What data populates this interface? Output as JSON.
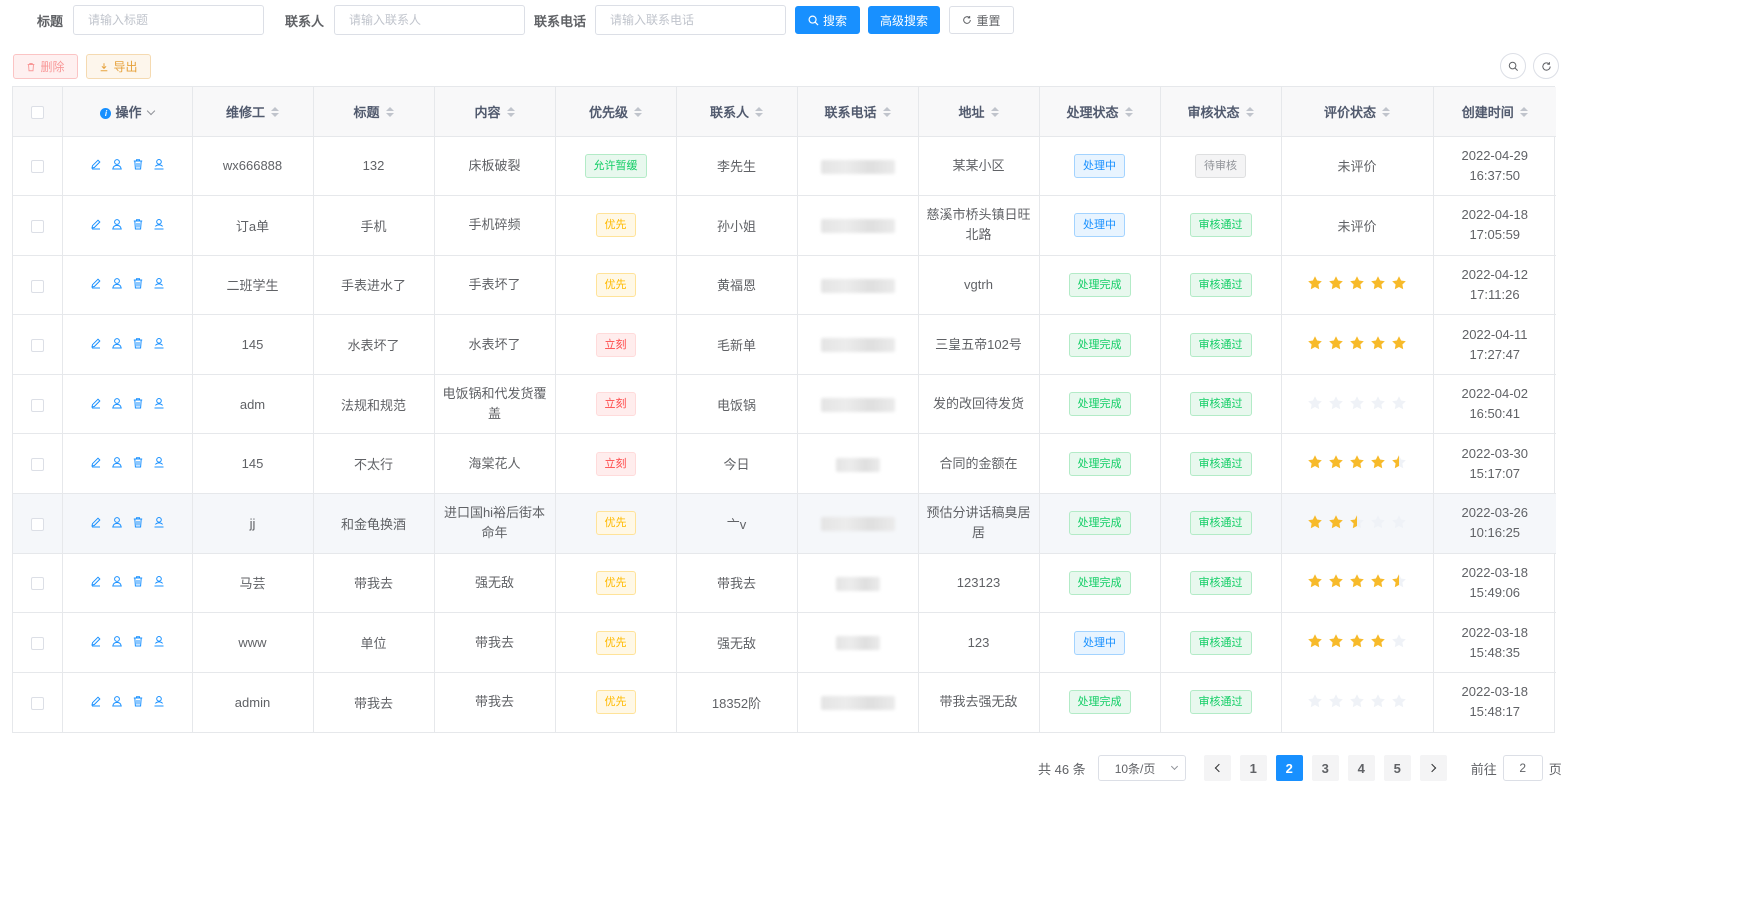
{
  "search": {
    "title_label": "标题",
    "title_placeholder": "请输入标题",
    "contact_label": "联系人",
    "contact_placeholder": "请输入联系人",
    "phone_label": "联系电话",
    "phone_placeholder": "请输入联系电话",
    "search_btn": "搜索",
    "advanced_btn": "高级搜索",
    "reset_btn": "重置"
  },
  "toolbar": {
    "delete_btn": "删除",
    "export_btn": "导出"
  },
  "table": {
    "headers": [
      "操作",
      "维修工",
      "标题",
      "内容",
      "优先级",
      "联系人",
      "联系电话",
      "地址",
      "处理状态",
      "审核状态",
      "评价状态",
      "创建时间"
    ],
    "rows": [
      {
        "worker": "wx666888",
        "title": "132",
        "content": "床板破裂",
        "priority": "允许暂缓",
        "priority_type": "success",
        "contact": "李先生",
        "address": "某某小区",
        "status": "处理中",
        "status_type": "primary",
        "audit": "待审核",
        "audit_type": "info",
        "eval_text": "未评价",
        "rating": null,
        "time": "2022-04-29 16:37:50"
      },
      {
        "worker": "订a单",
        "title": "手机",
        "content": "手机碎频",
        "priority": "优先",
        "priority_type": "warning",
        "contact": "孙小姐",
        "address": "慈溪市桥头镇日旺北路",
        "status": "处理中",
        "status_type": "primary",
        "audit": "审核通过",
        "audit_type": "success",
        "eval_text": "未评价",
        "rating": null,
        "time": "2022-04-18 17:05:59"
      },
      {
        "worker": "二班学生",
        "title": "手表进水了",
        "content": "手表坏了",
        "priority": "优先",
        "priority_type": "warning",
        "contact": "黄福恩",
        "address": "vgtrh",
        "status": "处理完成",
        "status_type": "success",
        "audit": "审核通过",
        "audit_type": "success",
        "eval_text": "",
        "rating": 5,
        "time": "2022-04-12 17:11:26"
      },
      {
        "worker": "145",
        "title": "水表坏了",
        "content": "水表坏了",
        "priority": "立刻",
        "priority_type": "danger",
        "contact": "毛新单",
        "address": "三皇五帝102号",
        "status": "处理完成",
        "status_type": "success",
        "audit": "审核通过",
        "audit_type": "success",
        "eval_text": "",
        "rating": 5,
        "time": "2022-04-11 17:27:47"
      },
      {
        "worker": "adm",
        "title": "法规和规范",
        "content": "电饭锅和代发货覆盖",
        "priority": "立刻",
        "priority_type": "danger",
        "contact": "电饭锅",
        "address": "发的改回待发货",
        "status": "处理完成",
        "status_type": "success",
        "audit": "审核通过",
        "audit_type": "success",
        "eval_text": "",
        "rating": 0,
        "time": "2022-04-02 16:50:41"
      },
      {
        "worker": "145",
        "title": "不太行",
        "content": "海棠花人",
        "priority": "立刻",
        "priority_type": "danger",
        "contact": "今日",
        "address": "合同的金额在",
        "status": "处理完成",
        "status_type": "success",
        "audit": "审核通过",
        "audit_type": "success",
        "eval_text": "",
        "rating": 4.5,
        "time": "2022-03-30 15:17:07"
      },
      {
        "worker": "jj",
        "title": "和金龟换酒",
        "content": "进口国hi裕后街本命年",
        "priority": "优先",
        "priority_type": "warning",
        "contact": "亠v",
        "address": "预估分讲话稿臭居居",
        "status": "处理完成",
        "status_type": "success",
        "audit": "审核通过",
        "audit_type": "success",
        "eval_text": "",
        "rating": 2.5,
        "time": "2022-03-26 10:16:25"
      },
      {
        "worker": "马芸",
        "title": "带我去",
        "content": "强无敌",
        "priority": "优先",
        "priority_type": "warning",
        "contact": "带我去",
        "address": "123123",
        "status": "处理完成",
        "status_type": "success",
        "audit": "审核通过",
        "audit_type": "success",
        "eval_text": "",
        "rating": 4.5,
        "time": "2022-03-18 15:49:06"
      },
      {
        "worker": "www",
        "title": "单位",
        "content": "带我去",
        "priority": "优先",
        "priority_type": "warning",
        "contact": "强无敌",
        "address": "123",
        "status": "处理中",
        "status_type": "primary",
        "audit": "审核通过",
        "audit_type": "success",
        "eval_text": "",
        "rating": 4,
        "time": "2022-03-18 15:48:35"
      },
      {
        "worker": "admin",
        "title": "带我去",
        "content": "带我去",
        "priority": "优先",
        "priority_type": "warning",
        "contact": "18352阶",
        "address": "带我去强无敌",
        "status": "处理完成",
        "status_type": "success",
        "audit": "审核通过",
        "audit_type": "success",
        "eval_text": "",
        "rating": 0,
        "time": "2022-03-18 15:48:17"
      }
    ]
  },
  "pagination": {
    "total_text": "共 46 条",
    "page_size": "10条/页",
    "pages": [
      "1",
      "2",
      "3",
      "4",
      "5"
    ],
    "current": "2",
    "goto_label": "前往",
    "goto_value": "2",
    "page_unit": "页"
  },
  "colors": {
    "primary": "#1890ff",
    "star": "#f7ba2a",
    "star_off": "#eff2f7"
  },
  "icons": [
    "search-icon",
    "refresh-icon",
    "delete-icon",
    "download-icon",
    "edit-icon",
    "user-icon",
    "trash-icon",
    "assign-icon",
    "info-icon",
    "star-icon"
  ]
}
